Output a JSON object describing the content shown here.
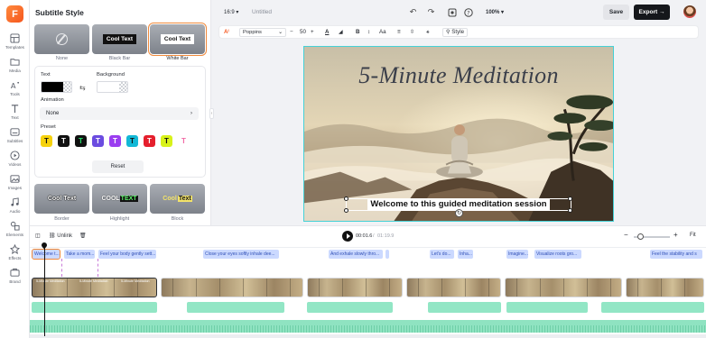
{
  "brand": {
    "logo_letter": "F",
    "accent": "#f5561e"
  },
  "rail": [
    {
      "label": "Templates",
      "icon": "templates-icon"
    },
    {
      "label": "Media",
      "icon": "media-icon"
    },
    {
      "label": "Tools",
      "icon": "tools-icon"
    },
    {
      "label": "Text",
      "icon": "text-icon"
    },
    {
      "label": "Subtitles",
      "icon": "subtitles-icon"
    },
    {
      "label": "Videos",
      "icon": "videos-icon"
    },
    {
      "label": "Images",
      "icon": "images-icon"
    },
    {
      "label": "Audio",
      "icon": "audio-icon"
    },
    {
      "label": "Elements",
      "icon": "elements-icon"
    },
    {
      "label": "Effects",
      "icon": "effects-icon"
    },
    {
      "label": "Brand",
      "icon": "brand-icon"
    }
  ],
  "panel": {
    "title": "Subtitle Style",
    "styles": [
      {
        "label": "None",
        "sample": ""
      },
      {
        "label": "Black Bar",
        "sample": "Cool Text"
      },
      {
        "label": "White Bar",
        "sample": "Cool Text"
      }
    ],
    "text_label": "Text",
    "background_label": "Background",
    "animation_label": "Animation",
    "animation_value": "None",
    "preset_label": "Preset",
    "presets": [
      {
        "letter": "T",
        "bg": "#f6d20c",
        "fg": "#111"
      },
      {
        "letter": "T",
        "bg": "#111111",
        "fg": "#fff"
      },
      {
        "letter": "T",
        "bg": "#111111",
        "fg": "#25e06a"
      },
      {
        "letter": "T",
        "bg": "#6b4ce0",
        "fg": "#fff"
      },
      {
        "letter": "T",
        "bg": "#9a3df0",
        "fg": "#fff"
      },
      {
        "letter": "T",
        "bg": "#12b8d6",
        "fg": "#111"
      },
      {
        "letter": "T",
        "bg": "#e51f2d",
        "fg": "#fff"
      },
      {
        "letter": "T",
        "bg": "#d8f21a",
        "fg": "#111"
      },
      {
        "letter": "T",
        "bg": "#ffffff",
        "fg": "#f26aa5"
      }
    ],
    "reset_label": "Reset",
    "more_styles": [
      {
        "label": "Border",
        "sample": "Cool Text"
      },
      {
        "label": "Highlight",
        "sample_a": "COOL",
        "sample_b": "TEXT"
      },
      {
        "label": "Block",
        "sample_a": "Cool",
        "sample_b": "Text"
      }
    ]
  },
  "topbar": {
    "ratio": "16:9",
    "project_title": "Untitled",
    "zoom": "100%",
    "save_label": "Save",
    "export_label": "Export"
  },
  "text_toolbar": {
    "ai_label": "Aᴵ",
    "font": "Poppins",
    "size": "50",
    "style_label": "Style",
    "aa_label": "Aa"
  },
  "canvas": {
    "title": "5-Minute Meditation",
    "subtitle": "Welcome to this guided meditation session"
  },
  "timeline": {
    "unlink_label": "Unlink",
    "current_time": "00:01.6",
    "total_time": "01:19.9",
    "fit_label": "Fit",
    "subtitle_chips": [
      "Welcome t...",
      "Take a mom...",
      "Feel your body gently sett...",
      "Close your eyes softly inhale dee...",
      "And exhale slowly thro...",
      "Let's do...",
      "Inha...",
      "Imagine...",
      "Visualize roots gro...",
      "Feel the stability and s"
    ],
    "clip_labels": [
      "5-Minute Meditation",
      "5-Minute Meditation",
      "5-Minute Meditation"
    ]
  }
}
